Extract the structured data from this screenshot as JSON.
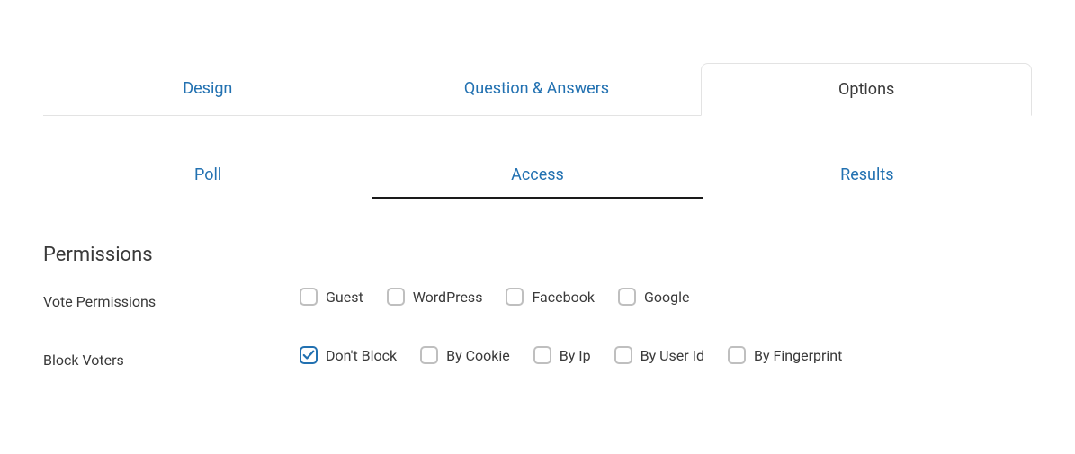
{
  "mainTabs": {
    "design": "Design",
    "qa": "Question & Answers",
    "options": "Options"
  },
  "subTabs": {
    "poll": "Poll",
    "access": "Access",
    "results": "Results"
  },
  "section": {
    "heading": "Permissions"
  },
  "votePermissions": {
    "label": "Vote Permissions",
    "options": {
      "guest": "Guest",
      "wordpress": "WordPress",
      "facebook": "Facebook",
      "google": "Google"
    }
  },
  "blockVoters": {
    "label": "Block Voters",
    "options": {
      "dontBlock": "Don't Block",
      "byCookie": "By Cookie",
      "byIp": "By Ip",
      "byUserId": "By User Id",
      "byFingerprint": "By Fingerprint"
    }
  }
}
